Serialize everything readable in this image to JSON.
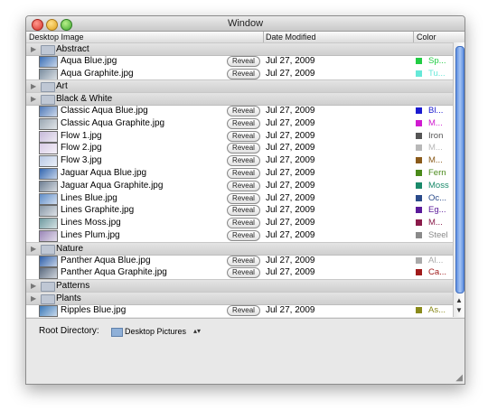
{
  "window": {
    "title": "Window"
  },
  "columns": {
    "image": "Desktop Image",
    "date": "Date Modified",
    "color": "Color"
  },
  "rows": [
    {
      "kind": "group",
      "name": "Abstract"
    },
    {
      "kind": "item",
      "name": "Aqua Blue.jpg",
      "reveal": "Reveal",
      "date": "Jul 27, 2009",
      "color": "#22cc44",
      "color_name": "Sp...",
      "thumb": "#3b6fb6"
    },
    {
      "kind": "item",
      "name": "Aqua Graphite.jpg",
      "reveal": "Reveal",
      "date": "Jul 27, 2009",
      "color": "#66e8d8",
      "color_name": "Tu...",
      "thumb": "#7b8ea0"
    },
    {
      "kind": "group",
      "name": "Art"
    },
    {
      "kind": "group",
      "name": "Black & White"
    },
    {
      "kind": "item",
      "name": "Classic Aqua Blue.jpg",
      "reveal": "Reveal",
      "date": "Jul 27, 2009",
      "color": "#1a1ad0",
      "color_name": "Bl...",
      "thumb": "#4f79b8"
    },
    {
      "kind": "item",
      "name": "Classic Aqua Graphite.jpg",
      "reveal": "Reveal",
      "date": "Jul 27, 2009",
      "color": "#d01ad0",
      "color_name": "M...",
      "thumb": "#9aa7b3"
    },
    {
      "kind": "item",
      "name": "Flow 1.jpg",
      "reveal": "Reveal",
      "date": "Jul 27, 2009",
      "color": "#555555",
      "color_name": "Iron",
      "thumb": "#c6b9d9"
    },
    {
      "kind": "item",
      "name": "Flow 2.jpg",
      "reveal": "Reveal",
      "date": "Jul 27, 2009",
      "color": "#b8b8b8",
      "color_name": "M...",
      "thumb": "#d8cbe6"
    },
    {
      "kind": "item",
      "name": "Flow 3.jpg",
      "reveal": "Reveal",
      "date": "Jul 27, 2009",
      "color": "#8a5a1a",
      "color_name": "M...",
      "thumb": "#b9c9e5"
    },
    {
      "kind": "item",
      "name": "Jaguar Aqua Blue.jpg",
      "reveal": "Reveal",
      "date": "Jul 27, 2009",
      "color": "#4a8a1a",
      "color_name": "Fern",
      "thumb": "#3266b0"
    },
    {
      "kind": "item",
      "name": "Jaguar Aqua Graphite.jpg",
      "reveal": "Reveal",
      "date": "Jul 27, 2009",
      "color": "#1a8a6a",
      "color_name": "Moss",
      "thumb": "#6e7f93"
    },
    {
      "kind": "item",
      "name": "Lines Blue.jpg",
      "reveal": "Reveal",
      "date": "Jul 27, 2009",
      "color": "#2a4a8a",
      "color_name": "Oc...",
      "thumb": "#5e8cc8"
    },
    {
      "kind": "item",
      "name": "Lines Graphite.jpg",
      "reveal": "Reveal",
      "date": "Jul 27, 2009",
      "color": "#5a1a9a",
      "color_name": "Eg...",
      "thumb": "#8898a8"
    },
    {
      "kind": "item",
      "name": "Lines Moss.jpg",
      "reveal": "Reveal",
      "date": "Jul 27, 2009",
      "color": "#8a1a4a",
      "color_name": "M...",
      "thumb": "#6e9aa0"
    },
    {
      "kind": "item",
      "name": "Lines Plum.jpg",
      "reveal": "Reveal",
      "date": "Jul 27, 2009",
      "color": "#8a8a8a",
      "color_name": "Steel",
      "thumb": "#9a86b8"
    },
    {
      "kind": "group",
      "name": "Nature"
    },
    {
      "kind": "item",
      "name": "Panther Aqua Blue.jpg",
      "reveal": "Reveal",
      "date": "Jul 27, 2009",
      "color": "#aaaaaa",
      "color_name": "Al...",
      "thumb": "#2d5ea8"
    },
    {
      "kind": "item",
      "name": "Panther Aqua Graphite.jpg",
      "reveal": "Reveal",
      "date": "Jul 27, 2009",
      "color": "#a01a1a",
      "color_name": "Ca...",
      "thumb": "#5a6a80"
    },
    {
      "kind": "group",
      "name": "Patterns"
    },
    {
      "kind": "group",
      "name": "Plants"
    },
    {
      "kind": "item",
      "name": "Ripples Blue.jpg",
      "reveal": "Reveal",
      "date": "Jul 27, 2009",
      "color": "#8a8a1a",
      "color_name": "As...",
      "thumb": "#3a78b8"
    }
  ],
  "footer": {
    "root_label": "Root Directory:",
    "root_value": "Desktop Pictures"
  }
}
